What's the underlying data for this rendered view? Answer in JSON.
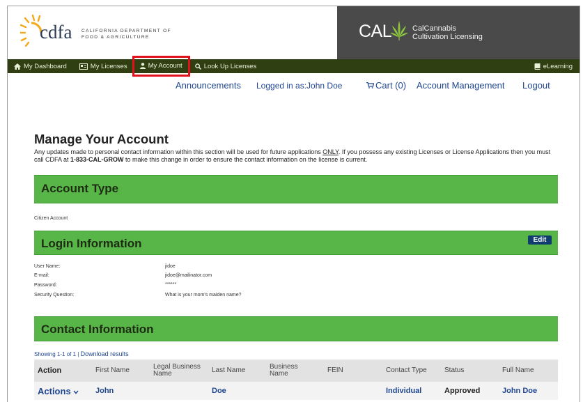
{
  "header": {
    "cdfa_word": "cdfa",
    "cdfa_sub_line1": "CALIFORNIA DEPARTMENT OF",
    "cdfa_sub_line2": "FOOD & AGRICULTURE",
    "cal_word": "CAL",
    "cal_sub_line1": "CalCannabis",
    "cal_sub_line2": "Cultivation Licensing"
  },
  "nav": {
    "items": [
      {
        "label": "My Dashboard",
        "icon": "home-icon"
      },
      {
        "label": "My Licenses",
        "icon": "license-card-icon"
      },
      {
        "label": "My Account",
        "icon": "user-icon"
      },
      {
        "label": "Look Up Licenses",
        "icon": "search-icon"
      }
    ],
    "right_label": "eLearning",
    "right_icon": "book-icon",
    "active_index": 2,
    "highlight_color": "#e0111b"
  },
  "toplinks": {
    "announcements": "Announcements",
    "logged_in": "Logged in as:John Doe",
    "cart": "Cart (0)",
    "account_management": "Account Management",
    "logout": "Logout"
  },
  "page": {
    "title": "Manage Your Account",
    "intro_part1": "Any updates made to personal contact information within this section will be used for future applications ",
    "intro_only": "ONLY",
    "intro_part2": ". If you possess any existing Licenses or License Applications then you must call CDFA at ",
    "intro_phone": "1-833-CAL-GROW",
    "intro_part3": " to make this change in order to ensure the contact information on the license is current."
  },
  "account_type": {
    "title": "Account Type",
    "value": "Citizen Account"
  },
  "login_info": {
    "title": "Login Information",
    "edit_label": "Edit",
    "fields": [
      {
        "label": "User Name:",
        "value": "jidoe"
      },
      {
        "label": "E-mail:",
        "value": "jidoe@mailinator.com"
      },
      {
        "label": "Password:",
        "value": "******"
      },
      {
        "label": "Security Question:",
        "value": "What is your mom's maiden name?"
      }
    ]
  },
  "contact_info": {
    "title": "Contact Information",
    "showing": "Showing 1-1 of 1",
    "separator": "|",
    "download": "Download results",
    "columns": [
      "Action",
      "First Name",
      "Legal Business Name",
      "Last Name",
      "Business Name",
      "FEIN",
      "Contact Type",
      "Status",
      "Full Name"
    ],
    "rows": [
      {
        "action": "Actions",
        "first_name": "John",
        "legal_business_name": "",
        "last_name": "Doe",
        "business_name": "",
        "fein": "",
        "contact_type": "Individual",
        "status": "Approved",
        "full_name": "John Doe"
      }
    ]
  },
  "colors": {
    "nav_bg": "#2f3f12",
    "band_green": "#58b648",
    "link_blue": "#1f4690",
    "edit_button": "#0f3d6e",
    "header_dark": "#4a4a4a"
  }
}
